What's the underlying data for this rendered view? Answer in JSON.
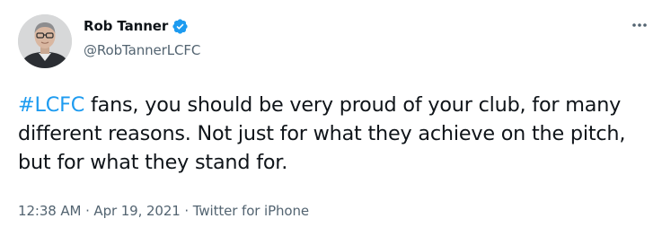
{
  "author": {
    "display_name": "Rob Tanner",
    "handle": "@RobTannerLCFC",
    "verified": true
  },
  "tweet": {
    "hashtag": "#LCFC",
    "text": " fans, you should be very proud of your club, for many different reasons. Not just for what they achieve on the pitch, but for what they stand for."
  },
  "meta": {
    "time": "12:38 AM",
    "separator_1": " · ",
    "date": "Apr 19, 2021",
    "separator_2": " · ",
    "source": "Twitter for iPhone"
  },
  "icons": {
    "verified": "verified-badge-icon",
    "more": "more-options-icon"
  },
  "colors": {
    "link": "#1d9bf0",
    "secondary_text": "#536471",
    "primary_text": "#0f1419"
  }
}
